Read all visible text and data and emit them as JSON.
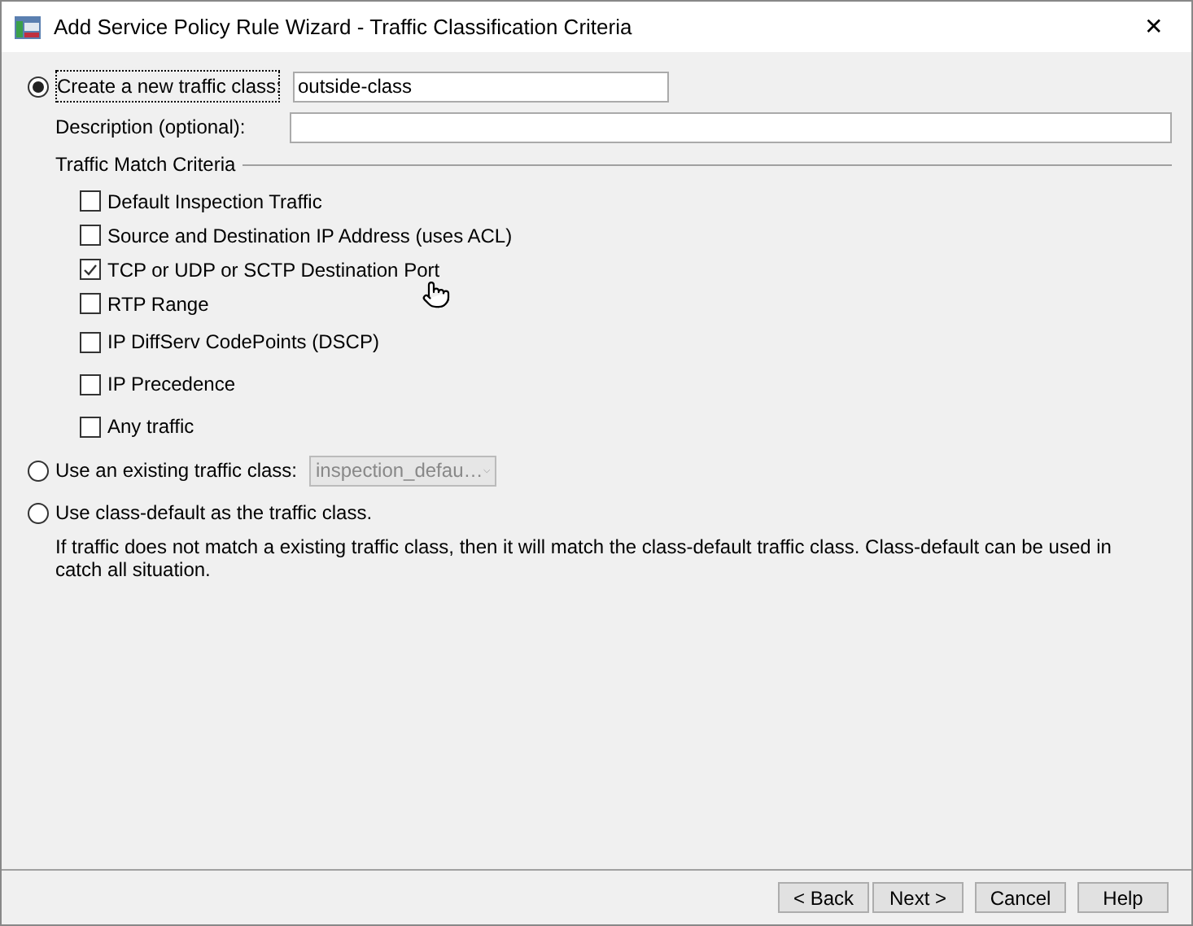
{
  "window": {
    "title": "Add Service Policy Rule Wizard - Traffic Classification Criteria",
    "close": "✕"
  },
  "new_class": {
    "label": "Create a new traffic class:",
    "selected": true,
    "value": "outside-class"
  },
  "description": {
    "label": "Description (optional):"
  },
  "criteria": {
    "title": "Traffic Match Criteria",
    "items": [
      {
        "label": "Default Inspection Traffic",
        "checked": false
      },
      {
        "label": "Source and Destination IP Address (uses ACL)",
        "checked": false
      },
      {
        "label": "TCP or UDP or SCTP Destination Port",
        "checked": true
      },
      {
        "label": "RTP Range",
        "checked": false
      },
      {
        "label": "IP DiffServ CodePoints (DSCP)",
        "checked": false
      },
      {
        "label": "IP Precedence",
        "checked": false
      },
      {
        "label": "Any traffic",
        "checked": false
      }
    ]
  },
  "existing_class": {
    "label": "Use an existing traffic class:",
    "selected": false,
    "value": "inspection_defau…",
    "disabled": true
  },
  "class_default": {
    "label": "Use class-default as the traffic class.",
    "selected": false,
    "note": "If traffic does not match a existing traffic class, then it will match the class-default traffic class. Class-default can be used in catch all situation."
  },
  "buttons": [
    {
      "label": "< Back"
    },
    {
      "label": "Next >"
    },
    {
      "label": "Cancel"
    },
    {
      "label": "Help"
    }
  ]
}
